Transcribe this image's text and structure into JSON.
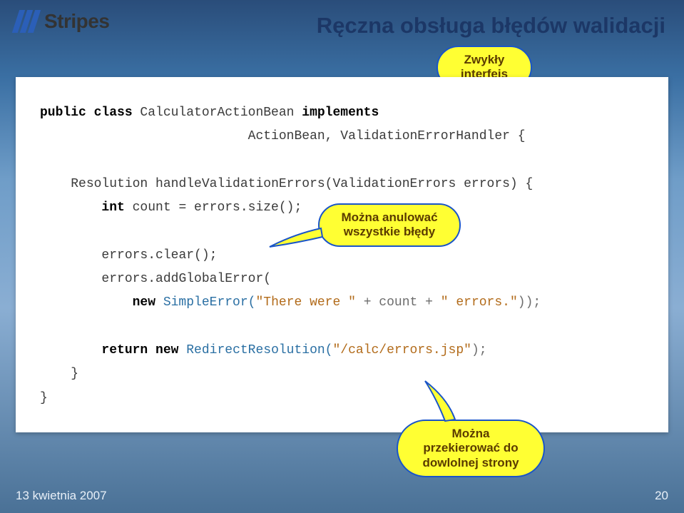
{
  "logo": {
    "text": "Stripes"
  },
  "title": "Ręczna obsługa błędów walidacji",
  "callouts": {
    "c1": {
      "line1": "Zwykły",
      "line2": "interfejs"
    },
    "c2": {
      "line1": "Można anulować",
      "line2": "wszystkie błędy"
    },
    "c3": {
      "line1": "Można",
      "line2": "przekierować do",
      "line3": "dowlolnej strony"
    }
  },
  "code": {
    "l1a": "public class",
    "l1b": " CalculatorActionBean ",
    "l1c": "implements",
    "l2a": "ActionBean, ValidationErrorHandler {",
    "l3a": "Resolution handleValidationErrors(ValidationErrors errors) {",
    "l4a": "int",
    "l4b": " count = errors.size();",
    "l5a": "errors.clear();",
    "l6a": "errors.addGlobalError(",
    "l7a": "new",
    "l7b": " SimpleError(",
    "l7c": "\"There were \"",
    "l7d": " + count + ",
    "l7e": "\" errors.\"",
    "l7f": "));",
    "l8a": "return new",
    "l8b": " RedirectResolution(",
    "l8c": "\"/calc/errors.jsp\"",
    "l8d": ");",
    "l9a": "}",
    "l10a": "}"
  },
  "footer": {
    "date": "13 kwietnia 2007",
    "page": "20"
  }
}
